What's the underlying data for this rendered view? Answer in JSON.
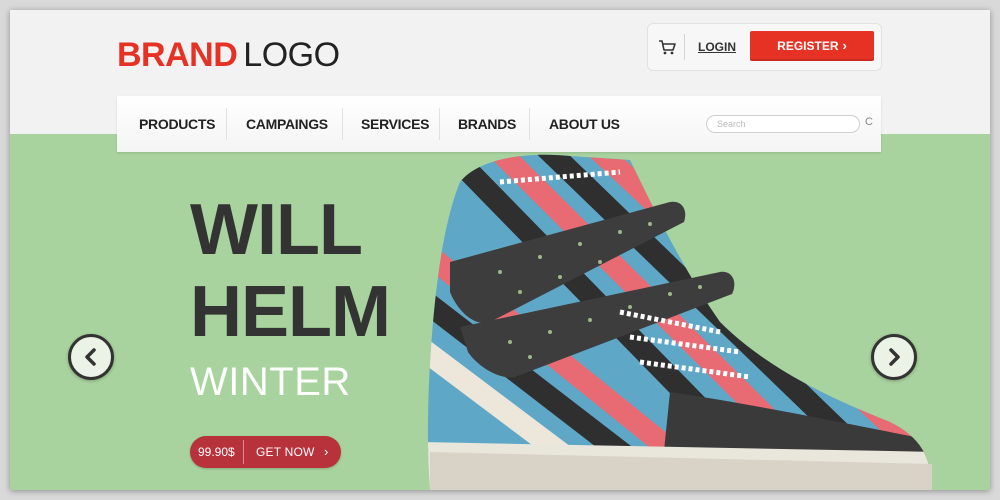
{
  "header": {
    "logo": {
      "brand": "BRAND",
      "word": "LOGO"
    },
    "account": {
      "login_label": "LOGIN",
      "register_label": "REGISTER",
      "cart_icon": "cart-icon"
    }
  },
  "nav": {
    "items": [
      {
        "label": "PRODUCTS"
      },
      {
        "label": "CAMPAINGS"
      },
      {
        "label": "SERVICES"
      },
      {
        "label": "BRANDS"
      },
      {
        "label": "ABOUT US"
      }
    ],
    "search": {
      "placeholder": "Search",
      "icon": "search-icon"
    }
  },
  "hero": {
    "headline_line1": "WILL",
    "headline_line2": "HELM",
    "subheadline": "WINTER",
    "price": "99.90$",
    "cta_label": "GET NOW",
    "prev_icon": "chevron-left-icon",
    "next_icon": "chevron-right-icon"
  },
  "colors": {
    "accent": "#e63225",
    "hero_bg": "#a8d29e",
    "cta_bg": "#b8323c",
    "text_dark": "#333333"
  }
}
